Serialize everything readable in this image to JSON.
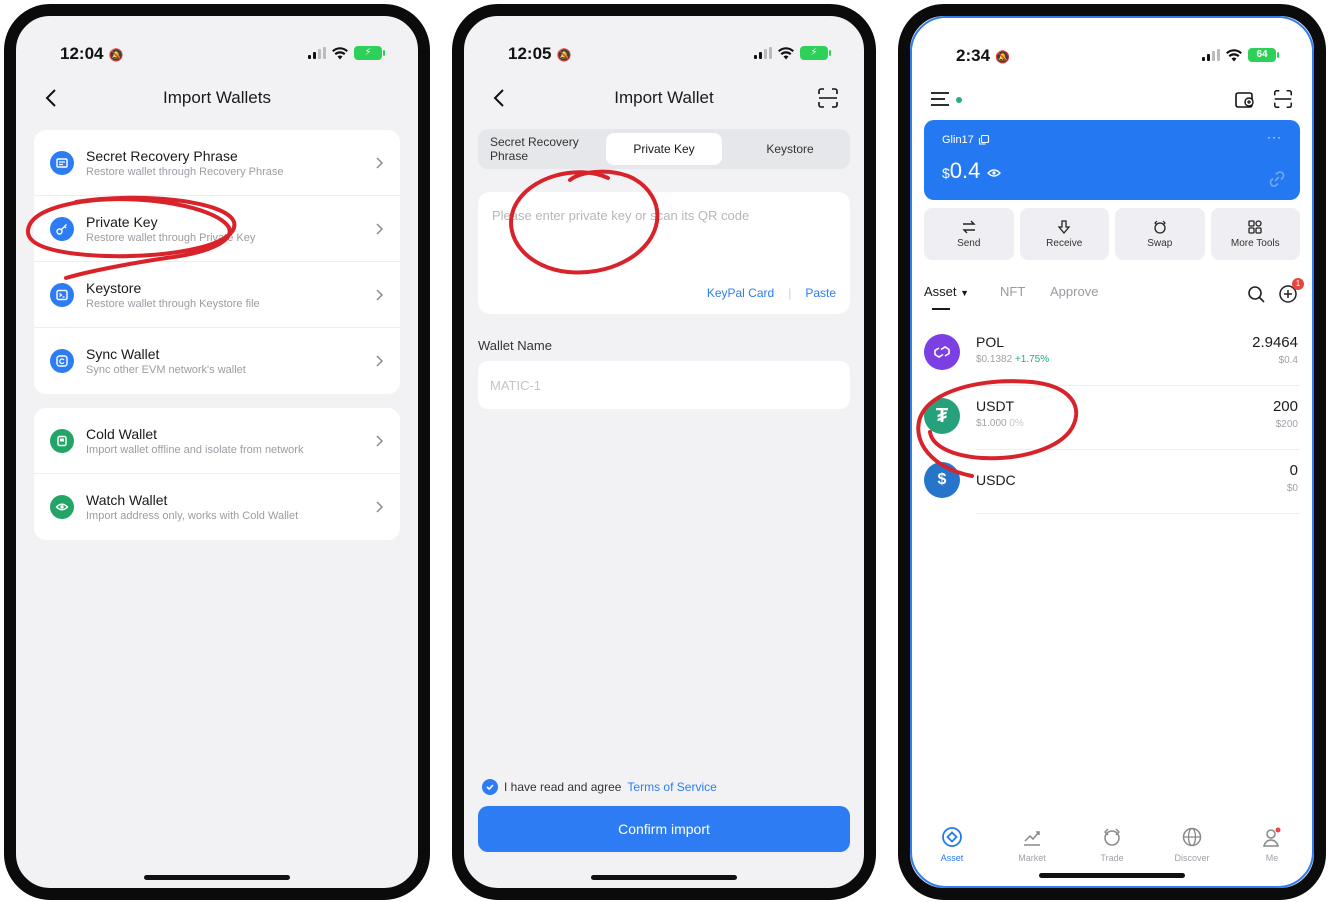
{
  "colors": {
    "accent": "#2d7cf3",
    "green": "#22a566",
    "annotation_red": "#d9232a",
    "positive": "#22b07d"
  },
  "phone1": {
    "time": "12:04",
    "title": "Import Wallets",
    "group1": [
      {
        "title": "Secret Recovery Phrase",
        "subtitle": "Restore wallet through Recovery Phrase",
        "icon": "document-icon"
      },
      {
        "title": "Private Key",
        "subtitle": "Restore wallet through Private Key",
        "icon": "key-icon"
      },
      {
        "title": "Keystore",
        "subtitle": "Restore wallet through Keystore file",
        "icon": "terminal-icon"
      },
      {
        "title": "Sync Wallet",
        "subtitle": "Sync other EVM network's wallet",
        "icon": "sync-icon"
      }
    ],
    "group2": [
      {
        "title": "Cold Wallet",
        "subtitle": "Import wallet offline and isolate from network",
        "icon": "cold-wallet-icon"
      },
      {
        "title": "Watch Wallet",
        "subtitle": "Import address only, works with Cold Wallet",
        "icon": "eye-icon"
      }
    ]
  },
  "phone2": {
    "time": "12:05",
    "title": "Import Wallet",
    "tabs": [
      "Secret Recovery Phrase",
      "Private Key",
      "Keystore"
    ],
    "active_tab": "Private Key",
    "placeholder": "Please enter private key or scan its QR code",
    "keypal": "KeyPal Card",
    "sep": "|",
    "paste": "Paste",
    "wallet_name_label": "Wallet Name",
    "wallet_name_placeholder": "MATIC-1",
    "agree_text": "I have read and agree",
    "terms": "Terms of Service",
    "confirm": "Confirm import"
  },
  "phone3": {
    "time": "2:34",
    "battery": "64",
    "wallet_name": "Glin17",
    "more": "···",
    "balance_currency": "$",
    "balance": "0.4",
    "actions": [
      "Send",
      "Receive",
      "Swap",
      "More Tools"
    ],
    "tabs": [
      "Asset",
      "NFT",
      "Approve"
    ],
    "badge": "1",
    "assets": [
      {
        "symbol": "POL",
        "price": "$0.1382",
        "change": "+1.75%",
        "amount": "2.9464",
        "fiat": "$0.4",
        "color": "#7b3fe4"
      },
      {
        "symbol": "USDT",
        "price": "$1.000",
        "change": "0%",
        "amount": "200",
        "fiat": "$200",
        "color": "#26a17b"
      },
      {
        "symbol": "USDC",
        "price": "",
        "change": "",
        "amount": "0",
        "fiat": "$0",
        "color": "#2775ca"
      }
    ],
    "tabbar": [
      "Asset",
      "Market",
      "Trade",
      "Discover",
      "Me"
    ]
  }
}
